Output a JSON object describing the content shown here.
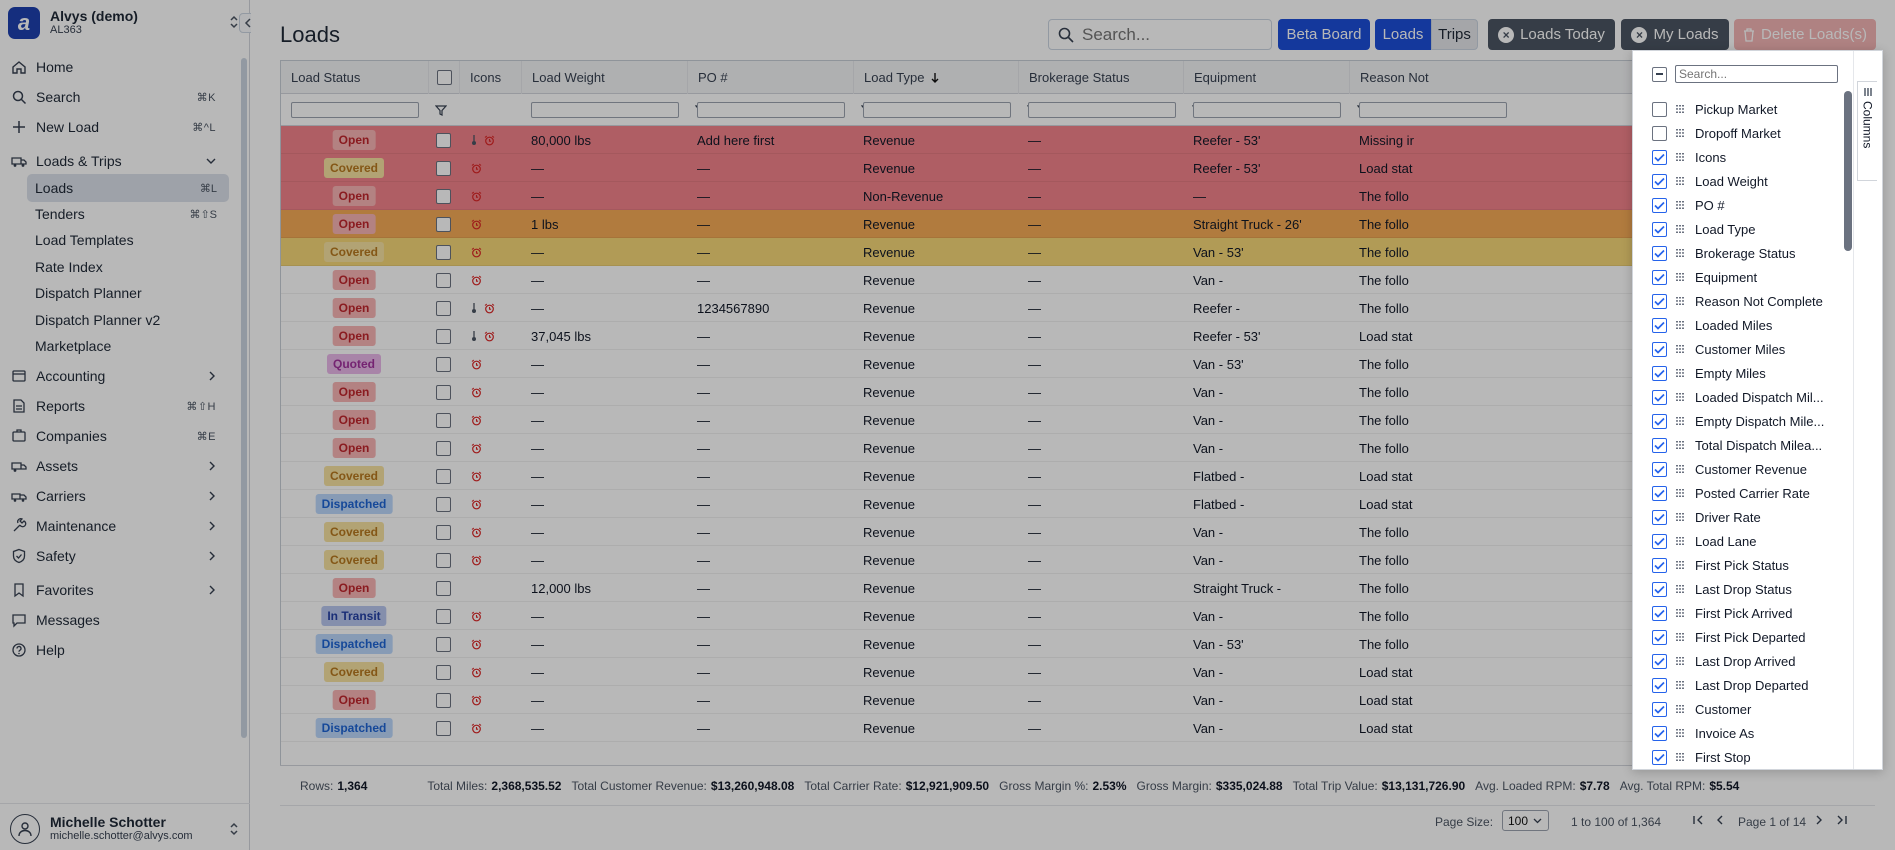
{
  "org": {
    "name": "Alvys (demo)",
    "code": "AL363",
    "logo_letter": "a"
  },
  "nav": [
    {
      "label": "Home",
      "icon": "home-icon",
      "kbd": ""
    },
    {
      "label": "Search",
      "icon": "search-icon",
      "kbd": "⌘K"
    },
    {
      "label": "New Load",
      "icon": "plus-icon",
      "kbd": "⌘^L"
    },
    {
      "label": "Loads & Trips",
      "icon": "loads-icon",
      "kbd": ""
    }
  ],
  "subnav": [
    {
      "label": "Loads",
      "kbd": "⌘L"
    },
    {
      "label": "Tenders",
      "kbd": "⌘⇧S"
    },
    {
      "label": "Load Templates",
      "kbd": ""
    },
    {
      "label": "Rate Index",
      "kbd": ""
    },
    {
      "label": "Dispatch Planner",
      "kbd": ""
    },
    {
      "label": "Dispatch Planner v2",
      "kbd": ""
    },
    {
      "label": "Marketplace",
      "kbd": ""
    }
  ],
  "nav2": [
    {
      "label": "Accounting",
      "icon": "accounting-icon",
      "kbd": ""
    },
    {
      "label": "Reports",
      "icon": "reports-icon",
      "kbd": "⌘⇧H"
    },
    {
      "label": "Companies",
      "icon": "companies-icon",
      "kbd": "⌘E"
    },
    {
      "label": "Assets",
      "icon": "assets-icon",
      "kbd": ""
    },
    {
      "label": "Carriers",
      "icon": "carriers-icon",
      "kbd": ""
    },
    {
      "label": "Maintenance",
      "icon": "maintenance-icon",
      "kbd": ""
    },
    {
      "label": "Safety",
      "icon": "shield-icon",
      "kbd": ""
    },
    {
      "label": "Favorites",
      "icon": "bookmark-icon",
      "kbd": ""
    },
    {
      "label": "Messages",
      "icon": "message-icon",
      "kbd": ""
    },
    {
      "label": "Help",
      "icon": "help-icon",
      "kbd": ""
    }
  ],
  "user": {
    "name": "Michelle Schotter",
    "email": "michelle.schotter@alvys.com"
  },
  "page": {
    "title": "Loads"
  },
  "toolbar": {
    "search_placeholder": "Search...",
    "beta_board": "Beta Board",
    "loads": "Loads",
    "trips": "Trips",
    "loads_today": "Loads Today",
    "my_loads": "My Loads",
    "delete_loads": "Delete Loads(s)"
  },
  "columns": [
    "Load Status",
    "",
    "Icons",
    "Load Weight",
    "PO #",
    "Load Type",
    "Brokerage Status",
    "Equipment",
    "Reason Not"
  ],
  "status_colors": {
    "Open": {
      "bg": "#f8b4b4",
      "fg": "#c0262d"
    },
    "Covered": {
      "bg": "#f7e2a1",
      "fg": "#b7791f"
    },
    "Quoted": {
      "bg": "#e9b8e9",
      "fg": "#a2319e"
    },
    "Dispatched": {
      "bg": "#bcd7fb",
      "fg": "#1e64d4"
    },
    "In Transit": {
      "bg": "#b9c7ef",
      "fg": "#2541a5"
    }
  },
  "row_tints": {
    "red": "#f3838b",
    "orange": "#f5ab56",
    "yellow": "#f6d778",
    "none": "#ffffff"
  },
  "rows": [
    {
      "status": "Open",
      "tint": "red",
      "icons": "temp-alarm",
      "weight": "80,000 lbs",
      "po": "Add here first",
      "type": "Revenue",
      "brokerage": "—",
      "equipment": "Reefer - 53'",
      "reason": "Missing ir"
    },
    {
      "status": "Covered",
      "tint": "red",
      "icons": "alarm",
      "weight": "—",
      "po": "—",
      "type": "Revenue",
      "brokerage": "—",
      "equipment": "Reefer - 53'",
      "reason": "Load stat"
    },
    {
      "status": "Open",
      "tint": "red",
      "icons": "alarm",
      "weight": "—",
      "po": "—",
      "type": "Non-Revenue",
      "brokerage": "—",
      "equipment": "—",
      "reason": "The follo"
    },
    {
      "status": "Open",
      "tint": "orange",
      "icons": "alarm",
      "weight": "1 lbs",
      "po": "—",
      "type": "Revenue",
      "brokerage": "—",
      "equipment": "Straight Truck - 26'",
      "reason": "The follo"
    },
    {
      "status": "Covered",
      "tint": "yellow",
      "icons": "alarm",
      "weight": "—",
      "po": "—",
      "type": "Revenue",
      "brokerage": "—",
      "equipment": "Van - 53'",
      "reason": "The follo"
    },
    {
      "status": "Open",
      "tint": "none",
      "icons": "alarm",
      "weight": "—",
      "po": "—",
      "type": "Revenue",
      "brokerage": "—",
      "equipment": "Van -",
      "reason": "The follo"
    },
    {
      "status": "Open",
      "tint": "none",
      "icons": "temp-alarm",
      "weight": "—",
      "po": "1234567890",
      "type": "Revenue",
      "brokerage": "—",
      "equipment": "Reefer -",
      "reason": "The follo"
    },
    {
      "status": "Open",
      "tint": "none",
      "icons": "temp-alarm",
      "weight": "37,045 lbs",
      "po": "—",
      "type": "Revenue",
      "brokerage": "—",
      "equipment": "Reefer - 53'",
      "reason": "Load stat"
    },
    {
      "status": "Quoted",
      "tint": "none",
      "icons": "alarm",
      "weight": "—",
      "po": "—",
      "type": "Revenue",
      "brokerage": "—",
      "equipment": "Van - 53'",
      "reason": "The follo"
    },
    {
      "status": "Open",
      "tint": "none",
      "icons": "alarm",
      "weight": "—",
      "po": "—",
      "type": "Revenue",
      "brokerage": "—",
      "equipment": "Van -",
      "reason": "The follo"
    },
    {
      "status": "Open",
      "tint": "none",
      "icons": "alarm",
      "weight": "—",
      "po": "—",
      "type": "Revenue",
      "brokerage": "—",
      "equipment": "Van -",
      "reason": "The follo"
    },
    {
      "status": "Open",
      "tint": "none",
      "icons": "alarm",
      "weight": "—",
      "po": "—",
      "type": "Revenue",
      "brokerage": "—",
      "equipment": "Van -",
      "reason": "The follo"
    },
    {
      "status": "Covered",
      "tint": "none",
      "icons": "alarm",
      "weight": "—",
      "po": "—",
      "type": "Revenue",
      "brokerage": "—",
      "equipment": "Flatbed -",
      "reason": "Load stat"
    },
    {
      "status": "Dispatched",
      "tint": "none",
      "icons": "alarm",
      "weight": "—",
      "po": "—",
      "type": "Revenue",
      "brokerage": "—",
      "equipment": "Flatbed -",
      "reason": "Load stat"
    },
    {
      "status": "Covered",
      "tint": "none",
      "icons": "alarm",
      "weight": "—",
      "po": "—",
      "type": "Revenue",
      "brokerage": "—",
      "equipment": "Van -",
      "reason": "The follo"
    },
    {
      "status": "Covered",
      "tint": "none",
      "icons": "alarm",
      "weight": "—",
      "po": "—",
      "type": "Revenue",
      "brokerage": "—",
      "equipment": "Van -",
      "reason": "The follo"
    },
    {
      "status": "Open",
      "tint": "none",
      "icons": "",
      "weight": "12,000 lbs",
      "po": "—",
      "type": "Revenue",
      "brokerage": "—",
      "equipment": "Straight Truck -",
      "reason": "The follo"
    },
    {
      "status": "In Transit",
      "tint": "none",
      "icons": "alarm",
      "weight": "—",
      "po": "—",
      "type": "Revenue",
      "brokerage": "—",
      "equipment": "Van -",
      "reason": "The follo"
    },
    {
      "status": "Dispatched",
      "tint": "none",
      "icons": "alarm",
      "weight": "—",
      "po": "—",
      "type": "Revenue",
      "brokerage": "—",
      "equipment": "Van - 53'",
      "reason": "The follo"
    },
    {
      "status": "Covered",
      "tint": "none",
      "icons": "alarm",
      "weight": "—",
      "po": "—",
      "type": "Revenue",
      "brokerage": "—",
      "equipment": "Van -",
      "reason": "Load stat"
    },
    {
      "status": "Open",
      "tint": "none",
      "icons": "alarm",
      "weight": "—",
      "po": "—",
      "type": "Revenue",
      "brokerage": "—",
      "equipment": "Van -",
      "reason": "Load stat"
    },
    {
      "status": "Dispatched",
      "tint": "none",
      "icons": "alarm",
      "weight": "—",
      "po": "—",
      "type": "Revenue",
      "brokerage": "—",
      "equipment": "Van -",
      "reason": "Load stat"
    }
  ],
  "footer": {
    "rows_label": "Rows:",
    "rows": "1,364",
    "miles_label": "Total Miles:",
    "miles": "2,368,535.52",
    "rev_label": "Total Customer Revenue:",
    "rev": "$13,260,948.08",
    "carrier_label": "Total Carrier Rate:",
    "carrier": "$12,921,909.50",
    "gmp_label": "Gross Margin %:",
    "gmp": "2.53%",
    "gm_label": "Gross Margin:",
    "gm": "$335,024.88",
    "trip_label": "Total Trip Value:",
    "trip": "$13,131,726.90",
    "lrpm_label": "Avg. Loaded RPM:",
    "lrpm": "$7.78",
    "trpm_label": "Avg. Total RPM:",
    "trpm": "$5.54"
  },
  "pagination": {
    "page_size_label": "Page Size:",
    "page_size": "100",
    "range": "1 to 100 of 1,364",
    "page": "Page 1 of 14"
  },
  "column_panel": {
    "search_placeholder": "Search...",
    "tab_label": "Columns",
    "items": [
      {
        "label": "Pickup Market",
        "checked": false
      },
      {
        "label": "Dropoff Market",
        "checked": false
      },
      {
        "label": "Icons",
        "checked": true
      },
      {
        "label": "Load Weight",
        "checked": true
      },
      {
        "label": "PO #",
        "checked": true
      },
      {
        "label": "Load Type",
        "checked": true
      },
      {
        "label": "Brokerage Status",
        "checked": true
      },
      {
        "label": "Equipment",
        "checked": true
      },
      {
        "label": "Reason Not Complete",
        "checked": true
      },
      {
        "label": "Loaded Miles",
        "checked": true
      },
      {
        "label": "Customer Miles",
        "checked": true
      },
      {
        "label": "Empty Miles",
        "checked": true
      },
      {
        "label": "Loaded Dispatch Mil...",
        "checked": true
      },
      {
        "label": "Empty Dispatch Mile...",
        "checked": true
      },
      {
        "label": "Total Dispatch Milea...",
        "checked": true
      },
      {
        "label": "Customer Revenue",
        "checked": true
      },
      {
        "label": "Posted Carrier Rate",
        "checked": true
      },
      {
        "label": "Driver Rate",
        "checked": true
      },
      {
        "label": "Load Lane",
        "checked": true
      },
      {
        "label": "First Pick Status",
        "checked": true
      },
      {
        "label": "Last Drop Status",
        "checked": true
      },
      {
        "label": "First Pick Arrived",
        "checked": true
      },
      {
        "label": "First Pick Departed",
        "checked": true
      },
      {
        "label": "Last Drop Arrived",
        "checked": true
      },
      {
        "label": "Last Drop Departed",
        "checked": true
      },
      {
        "label": "Customer",
        "checked": true
      },
      {
        "label": "Invoice As",
        "checked": true
      },
      {
        "label": "First Stop",
        "checked": true
      }
    ]
  }
}
